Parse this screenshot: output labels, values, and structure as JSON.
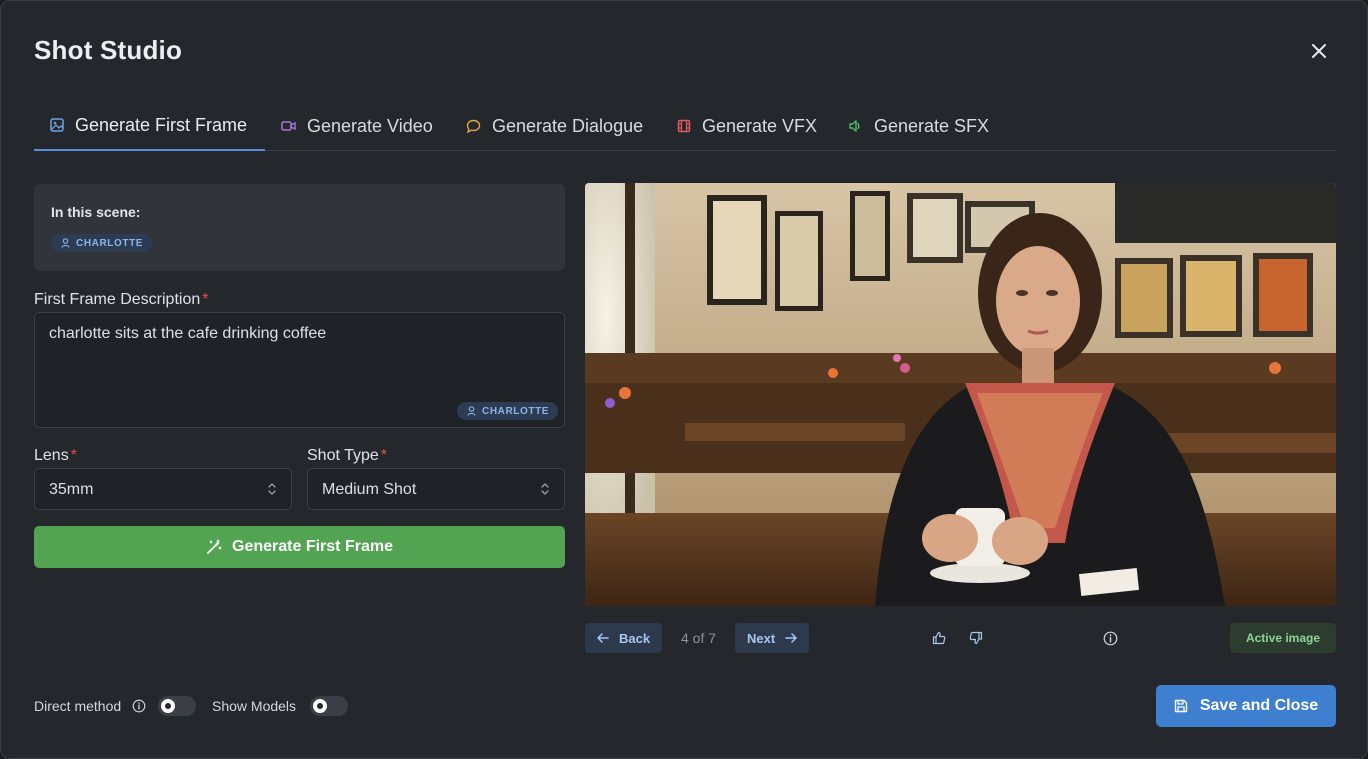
{
  "window": {
    "title": "Shot Studio"
  },
  "tabs": [
    {
      "label": "Generate First Frame",
      "icon": "image-icon",
      "color": "#6ea3e8",
      "active": true
    },
    {
      "label": "Generate Video",
      "icon": "video-camera-icon",
      "color": "#a676d9"
    },
    {
      "label": "Generate Dialogue",
      "icon": "speech-bubble-icon",
      "color": "#e0a646"
    },
    {
      "label": "Generate VFX",
      "icon": "film-icon",
      "color": "#e05c5c"
    },
    {
      "label": "Generate SFX",
      "icon": "speaker-icon",
      "color": "#4fbf6a"
    }
  ],
  "scene": {
    "label": "In this scene:",
    "characters": [
      "CHARLOTTE"
    ]
  },
  "description": {
    "label": "First Frame Description",
    "required_mark": "*",
    "value": "charlotte sits at the cafe drinking coffee",
    "tag": "CHARLOTTE"
  },
  "lens": {
    "label": "Lens",
    "required_mark": "*",
    "value": "35mm"
  },
  "shot_type": {
    "label": "Shot Type",
    "required_mark": "*",
    "value": "Medium Shot"
  },
  "generate_button": {
    "label": "Generate First Frame"
  },
  "image_nav": {
    "back_label": "Back",
    "counter": "4 of 7",
    "next_label": "Next",
    "status": "Active image"
  },
  "footer": {
    "direct_method_label": "Direct method",
    "direct_method_on": false,
    "show_models_label": "Show Models",
    "show_models_on": false,
    "save_label": "Save and Close"
  },
  "colors": {
    "accent": "#5b8fd9",
    "generate": "#52a452",
    "save": "#3f7fcf",
    "required": "#e05252"
  }
}
